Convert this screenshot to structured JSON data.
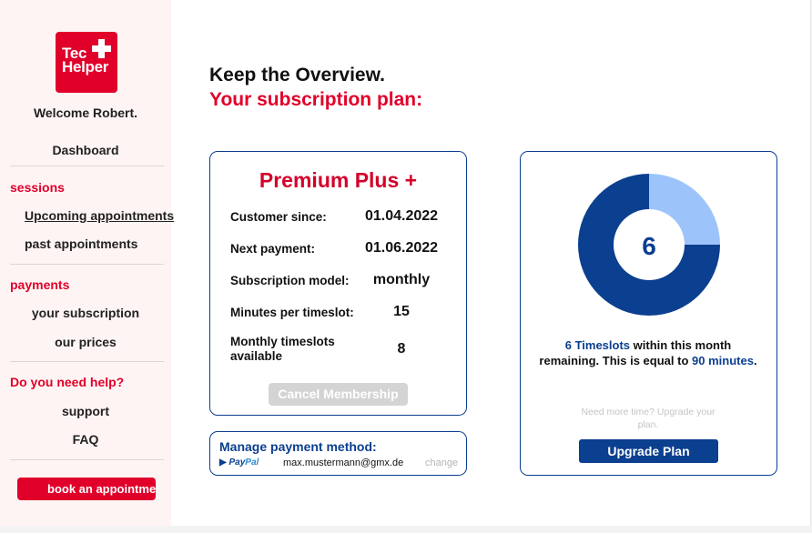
{
  "sidebar": {
    "logo_text_line1": "Tec",
    "logo_text_line2": "Helper",
    "welcome": "Welcome Robert.",
    "dashboard": "Dashboard",
    "sessions_heading": "sessions",
    "upcoming": "Upcoming appointments",
    "past": "past appointments",
    "payments_heading": "payments",
    "your_subscription": "your subscription",
    "our_prices": "our prices",
    "help_heading": "Do you need help?",
    "support": "support",
    "faq": "FAQ",
    "book_button": "book an appointment"
  },
  "main": {
    "heading_line1": "Keep the Overview.",
    "heading_line2": "Your subscription plan:"
  },
  "plan": {
    "title": "Premium Plus +",
    "rows": [
      {
        "label": "Customer since:",
        "value": "01.04.2022"
      },
      {
        "label": "Next payment:",
        "value": "01.06.2022"
      },
      {
        "label": "Subscription model:",
        "value": "monthly"
      },
      {
        "label": "Minutes per timeslot:",
        "value": "15"
      },
      {
        "label": "Monthly timeslots available",
        "value": "8"
      }
    ],
    "cancel_button": "Cancel Membership"
  },
  "payment": {
    "title": "Manage payment method:",
    "provider_part1": "Pay",
    "provider_part2": "Pal",
    "email": "max.mustermann@gmx.de",
    "change_link": "change"
  },
  "usage": {
    "center_number": "6",
    "remaining_timeslots": 6,
    "monthly_timeslots": 8,
    "colors": {
      "remaining": "#0b3f8f",
      "used": "#9cc4fb"
    },
    "text_highlight_timeslots": "6 Timeslots",
    "text_part2": " within this month remaining. This is equal to ",
    "text_highlight_minutes": "90 minutes",
    "text_part3": ".",
    "upgrade_note": "Need more time? Upgrade your plan.",
    "upgrade_button": "Upgrade Plan"
  },
  "colors": {
    "brand_red": "#e0002a",
    "brand_blue": "#0b3f8f"
  }
}
